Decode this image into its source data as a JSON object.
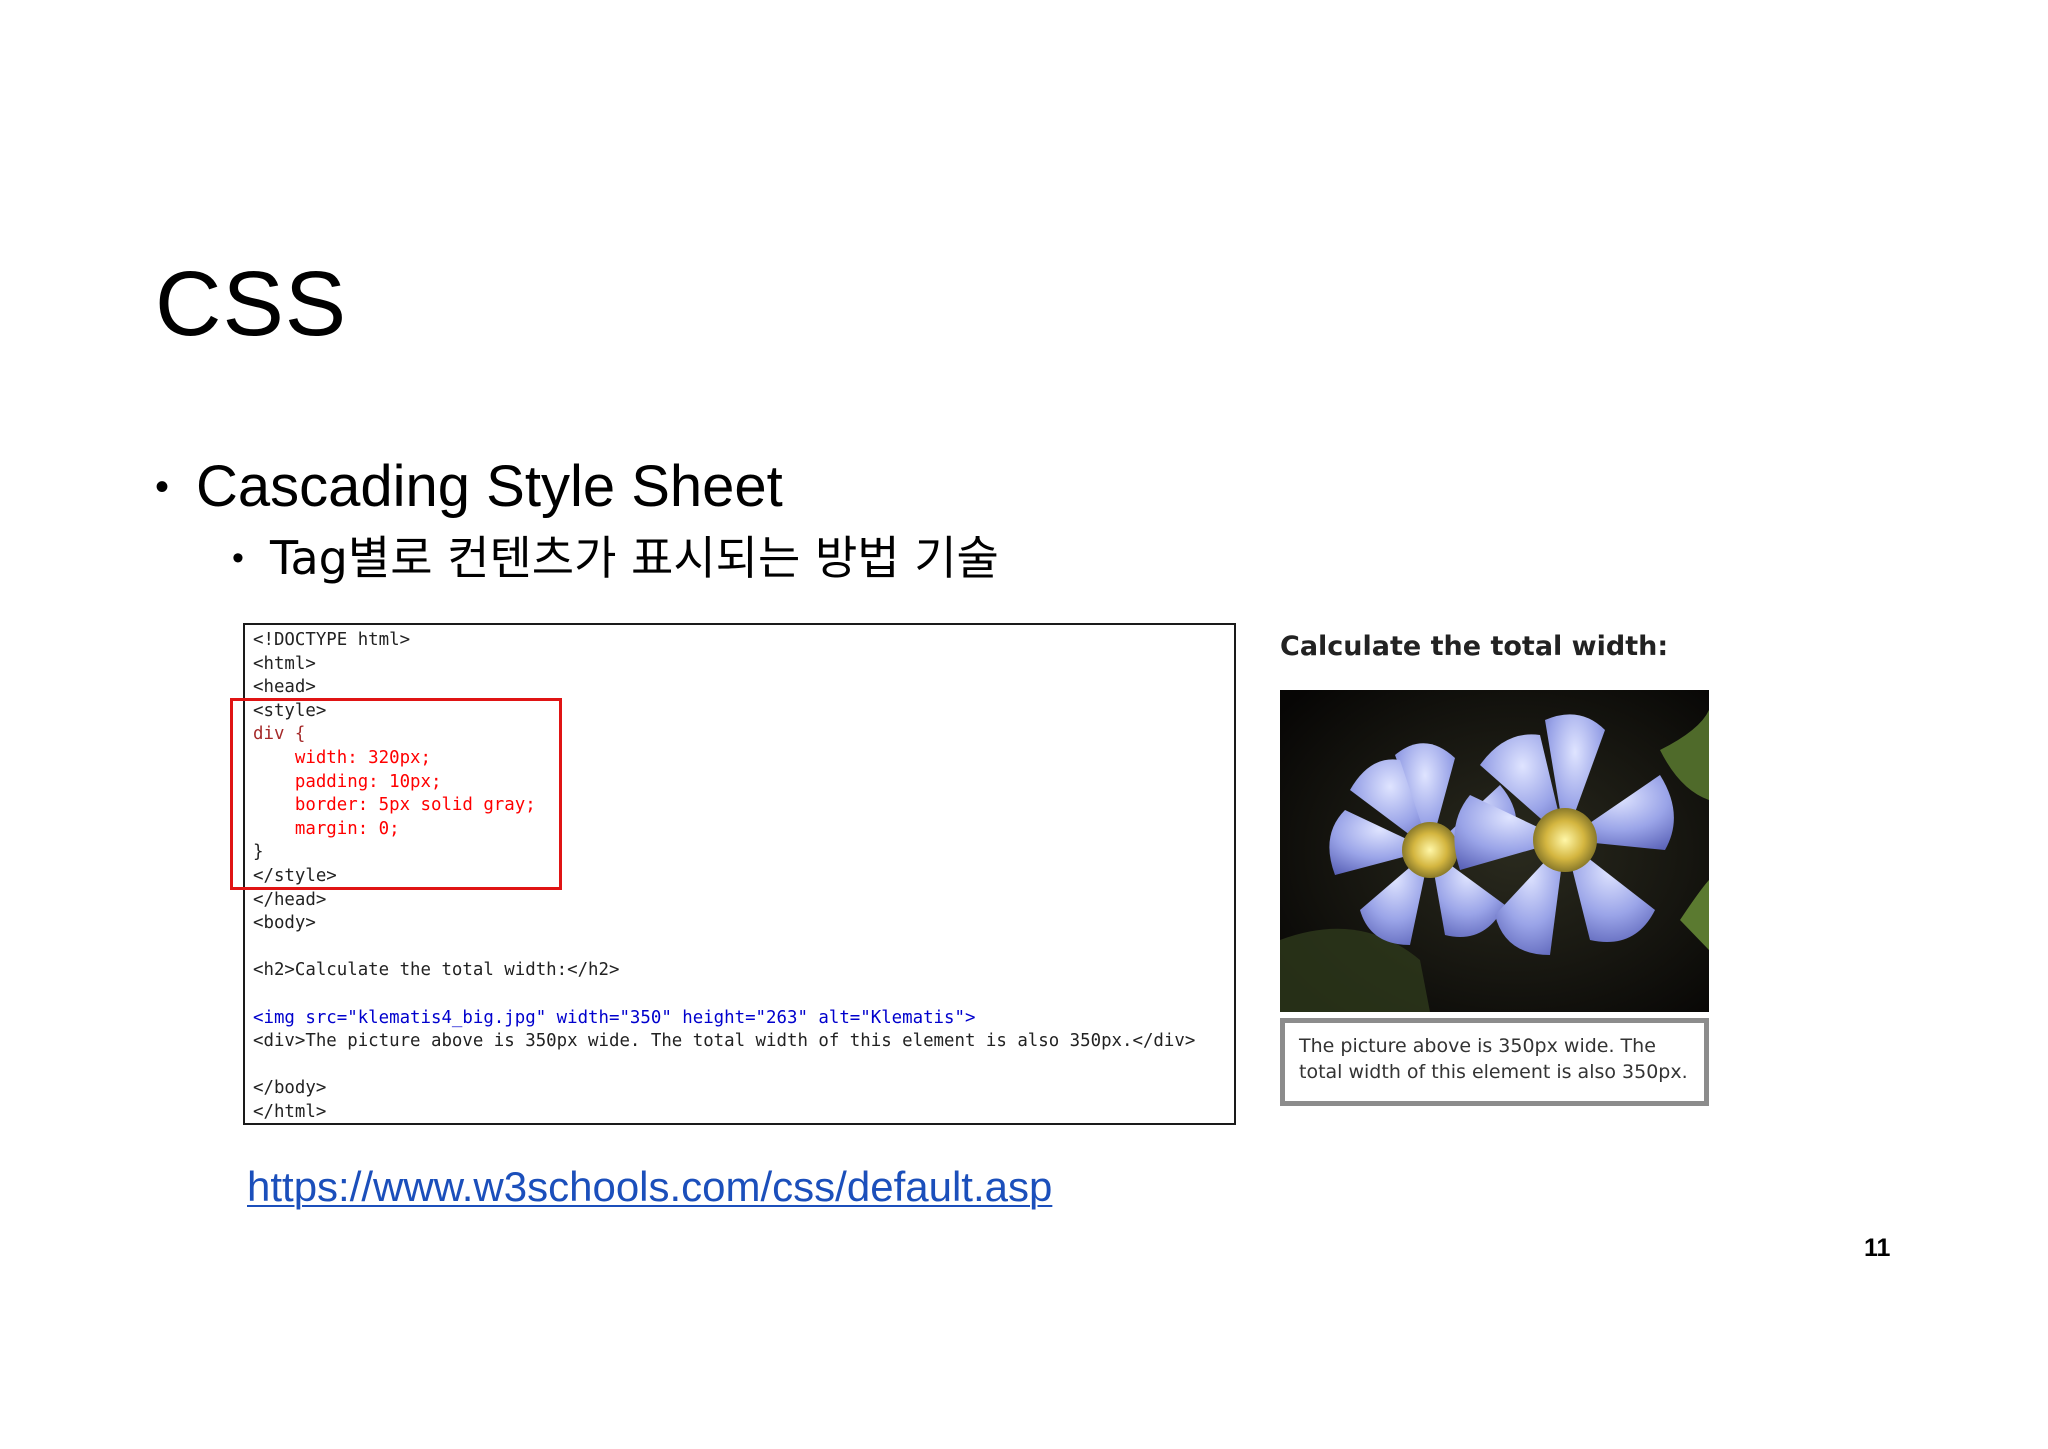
{
  "slide": {
    "title": "CSS",
    "bullet_l1": "Cascading Style Sheet",
    "bullet_l2": "Tag별로 컨텐츠가 표시되는 방법 기술",
    "bullet_marker": "•",
    "page_number": "11"
  },
  "code_screenshot": {
    "lines": [
      "<!DOCTYPE html>",
      "<html>",
      "<head>",
      "<style>",
      "div {",
      "    width: 320px;",
      "    padding: 10px;",
      "    border: 5px solid gray;",
      "    margin: 0;",
      "}",
      "</style>",
      "</head>",
      "<body>",
      "",
      "<h2>Calculate the total width:</h2>",
      "",
      "<img src=\"klematis4_big.jpg\" width=\"350\" height=\"263\" alt=\"Klematis\">",
      "<div>The picture above is 350px wide. The total width of this element is also 350px.</div>",
      "",
      "</body>",
      "</html>"
    ],
    "highlight_color": "#e01414"
  },
  "result_preview": {
    "heading": "Calculate the total width:",
    "caption": "The picture above is 350px wide. The total width of this element is also 350px.",
    "border_color": "#8c8c8c"
  },
  "source": {
    "link_text": "https://www.w3schools.com/css/default.asp",
    "link_color": "#1b4fbb"
  }
}
